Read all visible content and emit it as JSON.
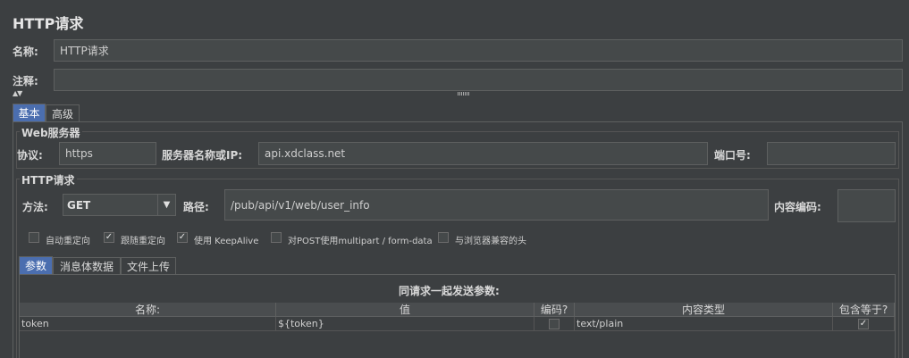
{
  "title": "HTTP请求",
  "name_label": "名称:",
  "name_value": "HTTP请求",
  "comment_label": "注释:",
  "comment_value": "",
  "collapse_arrows": "▲▼",
  "tabs": [
    "基本",
    "高级"
  ],
  "web_server": {
    "title": "Web服务器",
    "protocol_label": "协议:",
    "protocol_value": "https",
    "server_label": "服务器名称或IP:",
    "server_value": "api.xdclass.net",
    "port_label": "端口号:",
    "port_value": ""
  },
  "http_request": {
    "title": "HTTP请求",
    "method_label": "方法:",
    "method_value": "GET",
    "path_label": "路径:",
    "path_value": "/pub/api/v1/web/user_info",
    "encoding_label": "内容编码:",
    "encoding_value": ""
  },
  "options": [
    {
      "label": "自动重定向",
      "checked": false
    },
    {
      "label": "跟随重定向",
      "checked": true
    },
    {
      "label": "使用 KeepAlive",
      "checked": true
    },
    {
      "label": "对POST使用multipart / form-data",
      "checked": false
    },
    {
      "label": "与浏览器兼容的头",
      "checked": false
    }
  ],
  "sub_tabs": [
    "参数",
    "消息体数据",
    "文件上传"
  ],
  "params_table": {
    "caption": "同请求一起发送参数:",
    "headers": [
      "名称:",
      "值",
      "编码?",
      "内容类型",
      "包含等于?"
    ],
    "rows": [
      {
        "name": "token",
        "value": "${token}",
        "encode": false,
        "content_type": "text/plain",
        "include_equals": true
      }
    ]
  },
  "check_mark": "✓"
}
